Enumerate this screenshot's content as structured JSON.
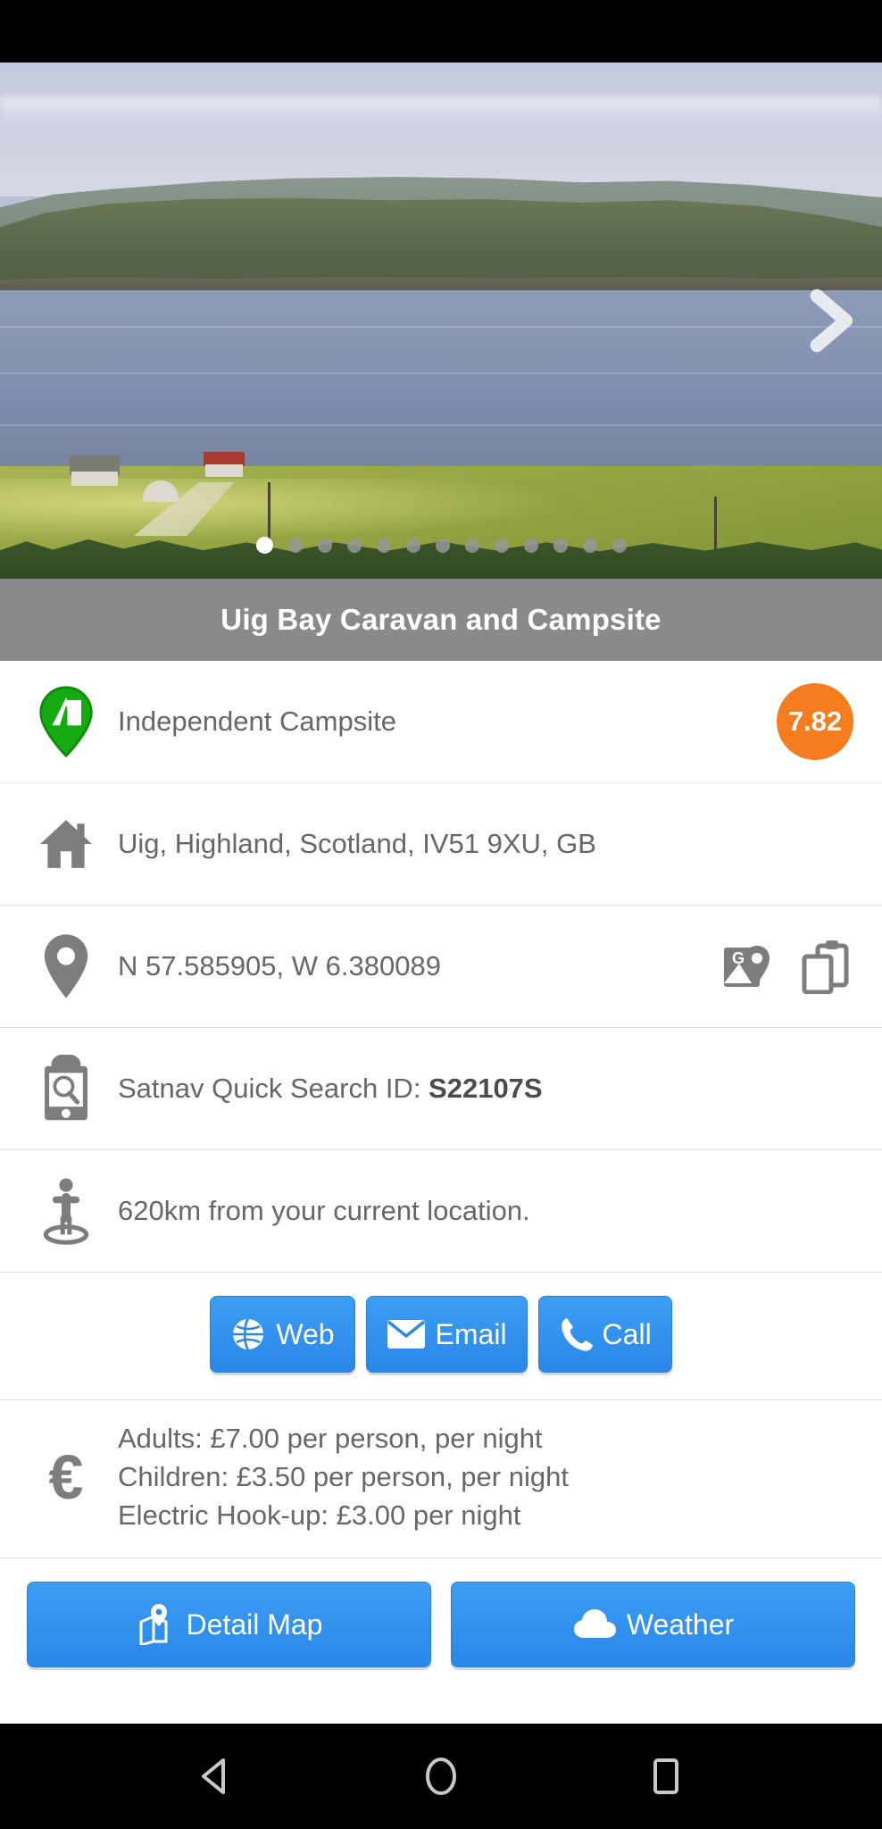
{
  "app": {
    "title": "Uig Bay Caravan and Campsite"
  },
  "carousel": {
    "dot_count": 13,
    "active_index": 0,
    "next_icon": "chevron-right-icon"
  },
  "rows": {
    "category": {
      "icon": "campsite-pin-icon",
      "label": "Independent Campsite",
      "rating": "7.82",
      "rating_color": "#f57c1f"
    },
    "address": {
      "icon": "home-icon",
      "label": "Uig, Highland, Scotland, IV51 9XU, GB"
    },
    "coordinates": {
      "icon": "location-pin-icon",
      "label": "N 57.585905, W 6.380089",
      "actions": [
        "google-maps-icon",
        "copy-clipboard-icon"
      ]
    },
    "satnav": {
      "icon": "satnav-search-icon",
      "label_prefix": "Satnav Quick Search ID: ",
      "id": "S22107S"
    },
    "distance": {
      "icon": "person-location-icon",
      "label": "620km from your current location."
    }
  },
  "contact_buttons": [
    {
      "label": "Web",
      "icon": "globe-icon"
    },
    {
      "label": "Email",
      "icon": "envelope-icon"
    },
    {
      "label": "Call",
      "icon": "phone-icon"
    }
  ],
  "pricing": {
    "icon": "euro-icon",
    "lines": [
      "Adults: £7.00 per person, per night",
      "Children: £3.50 per person, per night",
      "Electric Hook-up: £3.00 per night"
    ]
  },
  "bottom_buttons": [
    {
      "label": "Detail Map",
      "icon": "map-pin-icon"
    },
    {
      "label": "Weather",
      "icon": "cloud-icon"
    }
  ],
  "navbar": {
    "back": "back-triangle-icon",
    "home": "home-circle-icon",
    "recents": "recents-square-icon"
  },
  "colors": {
    "accent_blue": "#2f8ceb",
    "title_bar": "#8a8a8a",
    "rating_orange": "#f57c1f",
    "pin_green": "#14aa10"
  }
}
